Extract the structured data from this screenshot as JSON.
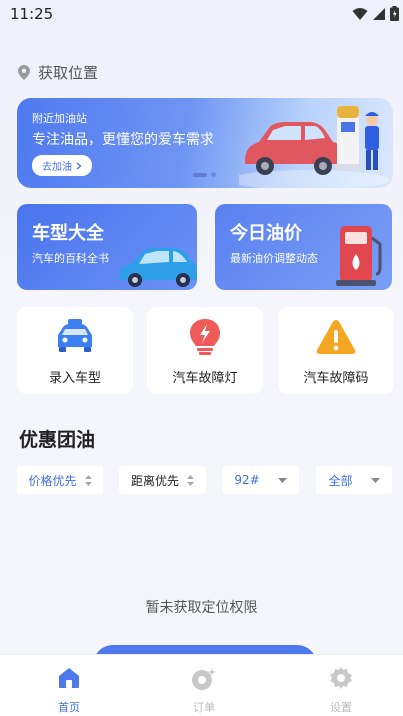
{
  "status_bar": {
    "time": "11:25"
  },
  "location": {
    "label": "获取位置",
    "icon": "location-pin-icon"
  },
  "banner": {
    "subtitle": "附近加油站",
    "title": "专注油品，更懂您的爱车需求",
    "button_label": "去加油",
    "button_icon": "chevron-right-icon"
  },
  "cards": [
    {
      "title": "车型大全",
      "subtitle": "汽车的百科全书",
      "icon": "car-illustration"
    },
    {
      "title": "今日油价",
      "subtitle": "最新油价调整动态",
      "icon": "fuel-pump-illustration"
    }
  ],
  "tiles": [
    {
      "label": "录入车型",
      "icon": "car-front-icon"
    },
    {
      "label": "汽车故障灯",
      "icon": "warning-light-icon"
    },
    {
      "label": "汽车故障码",
      "icon": "warning-triangle-icon"
    }
  ],
  "section": {
    "title": "优惠团油"
  },
  "filters": [
    {
      "label": "价格优先",
      "icon": "sort-icon",
      "color": "#3f6fe0"
    },
    {
      "label": "距离优先",
      "icon": "sort-icon",
      "color": "#222222"
    },
    {
      "label": "92#",
      "icon": "dropdown-icon",
      "color": "#3f6fe0"
    },
    {
      "label": "全部",
      "icon": "dropdown-icon",
      "color": "#3f6fe0"
    }
  ],
  "empty_state": {
    "message": "暂未获取定位权限"
  },
  "tabbar": [
    {
      "label": "首页",
      "icon": "home-icon",
      "active": true,
      "color": "#3f6fe0"
    },
    {
      "label": "订单",
      "icon": "order-icon",
      "active": false,
      "color": "#bbbbbb"
    },
    {
      "label": "设置",
      "icon": "settings-icon",
      "active": false,
      "color": "#bbbbbb"
    }
  ],
  "colors": {
    "primary": "#4d78ee",
    "background": "#f4f6fb"
  }
}
